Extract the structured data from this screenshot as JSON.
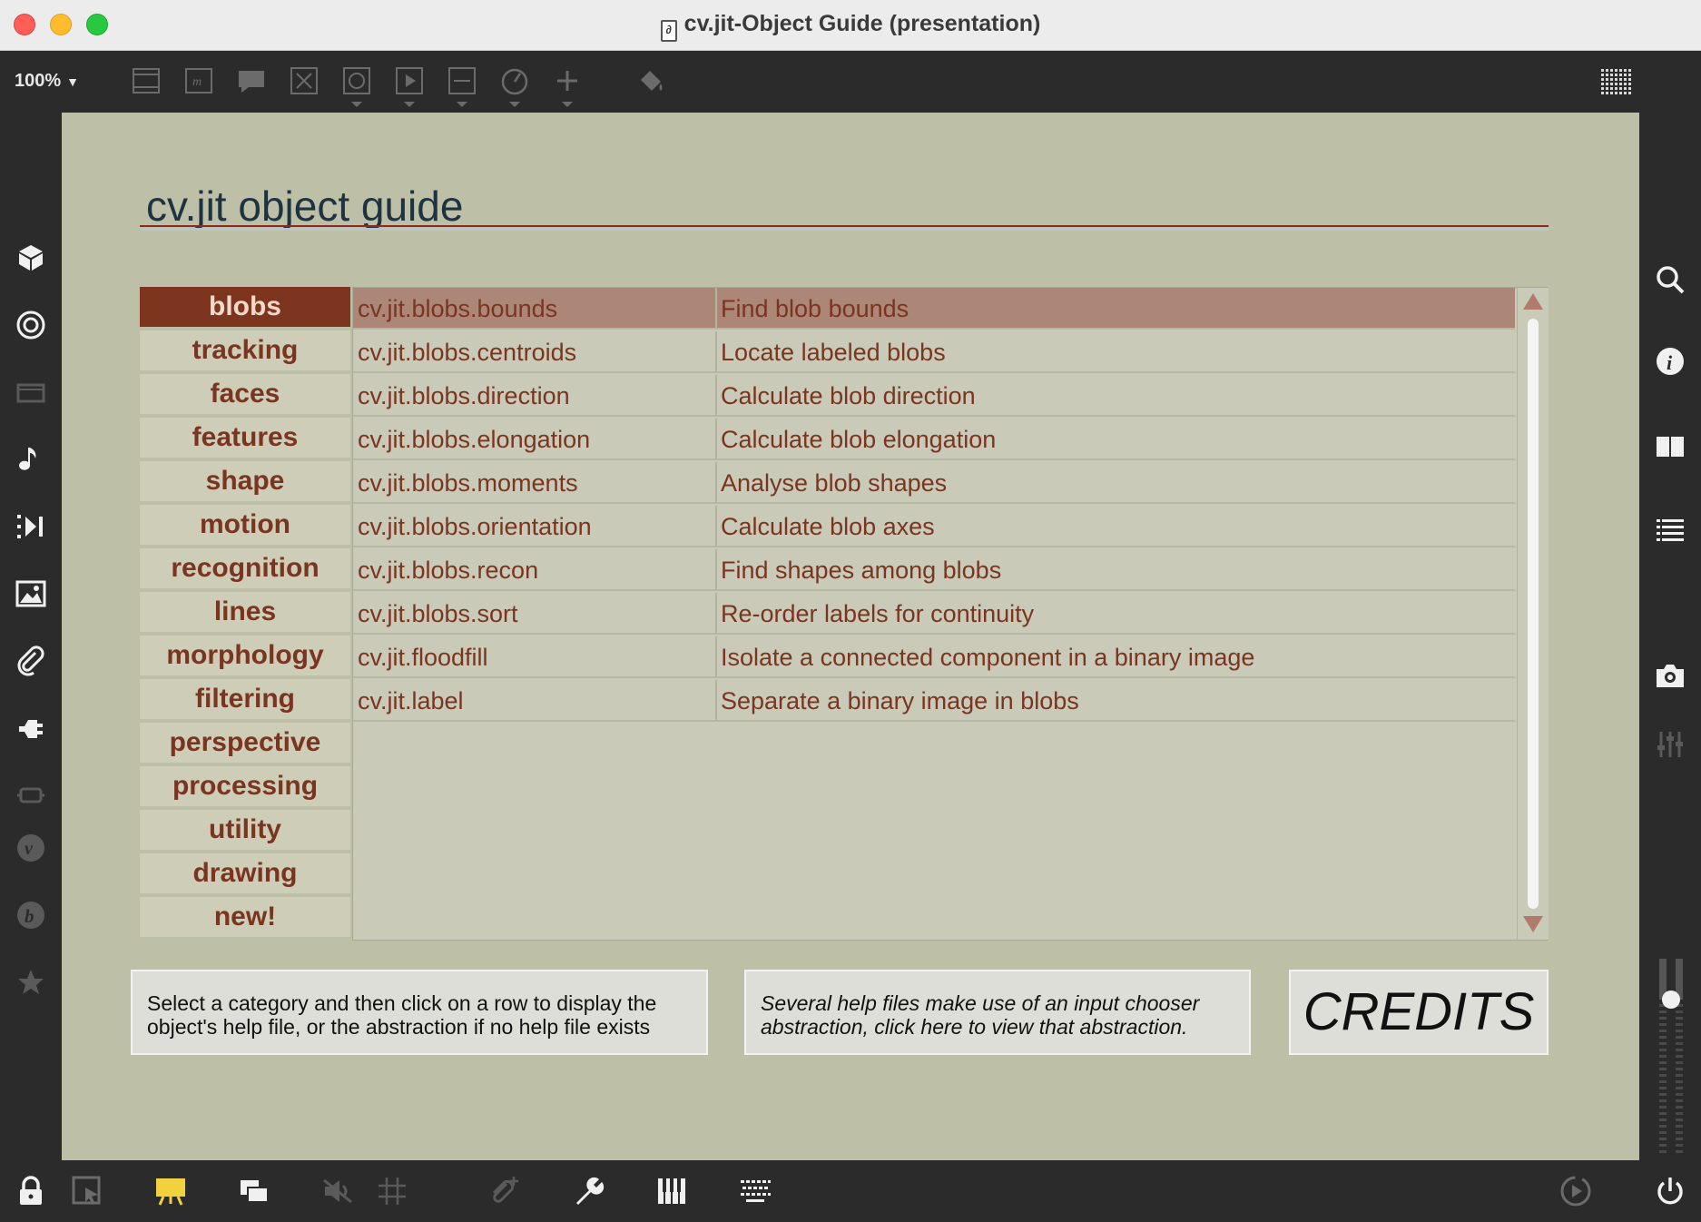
{
  "window": {
    "title": "cv.jit-Object Guide (presentation)"
  },
  "toolbar": {
    "zoom": "100%"
  },
  "page": {
    "title": "cv.jit object guide"
  },
  "categories": [
    "blobs",
    "tracking",
    "faces",
    "features",
    "shape",
    "motion",
    "recognition",
    "lines",
    "morphology",
    "filtering",
    "perspective",
    "processing",
    "utility",
    "drawing",
    "new!"
  ],
  "selected_category": "blobs",
  "rows": [
    {
      "name": "cv.jit.blobs.bounds",
      "desc": "Find blob bounds"
    },
    {
      "name": "cv.jit.blobs.centroids",
      "desc": "Locate labeled blobs"
    },
    {
      "name": "cv.jit.blobs.direction",
      "desc": "Calculate blob direction"
    },
    {
      "name": "cv.jit.blobs.elongation",
      "desc": "Calculate blob elongation"
    },
    {
      "name": "cv.jit.blobs.moments",
      "desc": "Analyse blob shapes"
    },
    {
      "name": "cv.jit.blobs.orientation",
      "desc": "Calculate blob axes"
    },
    {
      "name": "cv.jit.blobs.recon",
      "desc": "Find shapes among blobs"
    },
    {
      "name": "cv.jit.blobs.sort",
      "desc": "Re-order labels for continuity"
    },
    {
      "name": "cv.jit.floodfill",
      "desc": "Isolate a connected component in a binary image"
    },
    {
      "name": "cv.jit.label",
      "desc": "Separate a binary image in blobs"
    }
  ],
  "selected_row": 0,
  "help_text": "Select a category and then click on a row to display the object's help file, or the abstraction if no help file exists",
  "chooser_text": "Several help files make use of an input chooser abstraction, click here to view that abstraction.",
  "credits_label": "CREDITS",
  "colors": {
    "canvas": "#bdbfa6",
    "accent": "#7d3520",
    "selected_row": "#ac8677",
    "title": "#1d3342"
  }
}
